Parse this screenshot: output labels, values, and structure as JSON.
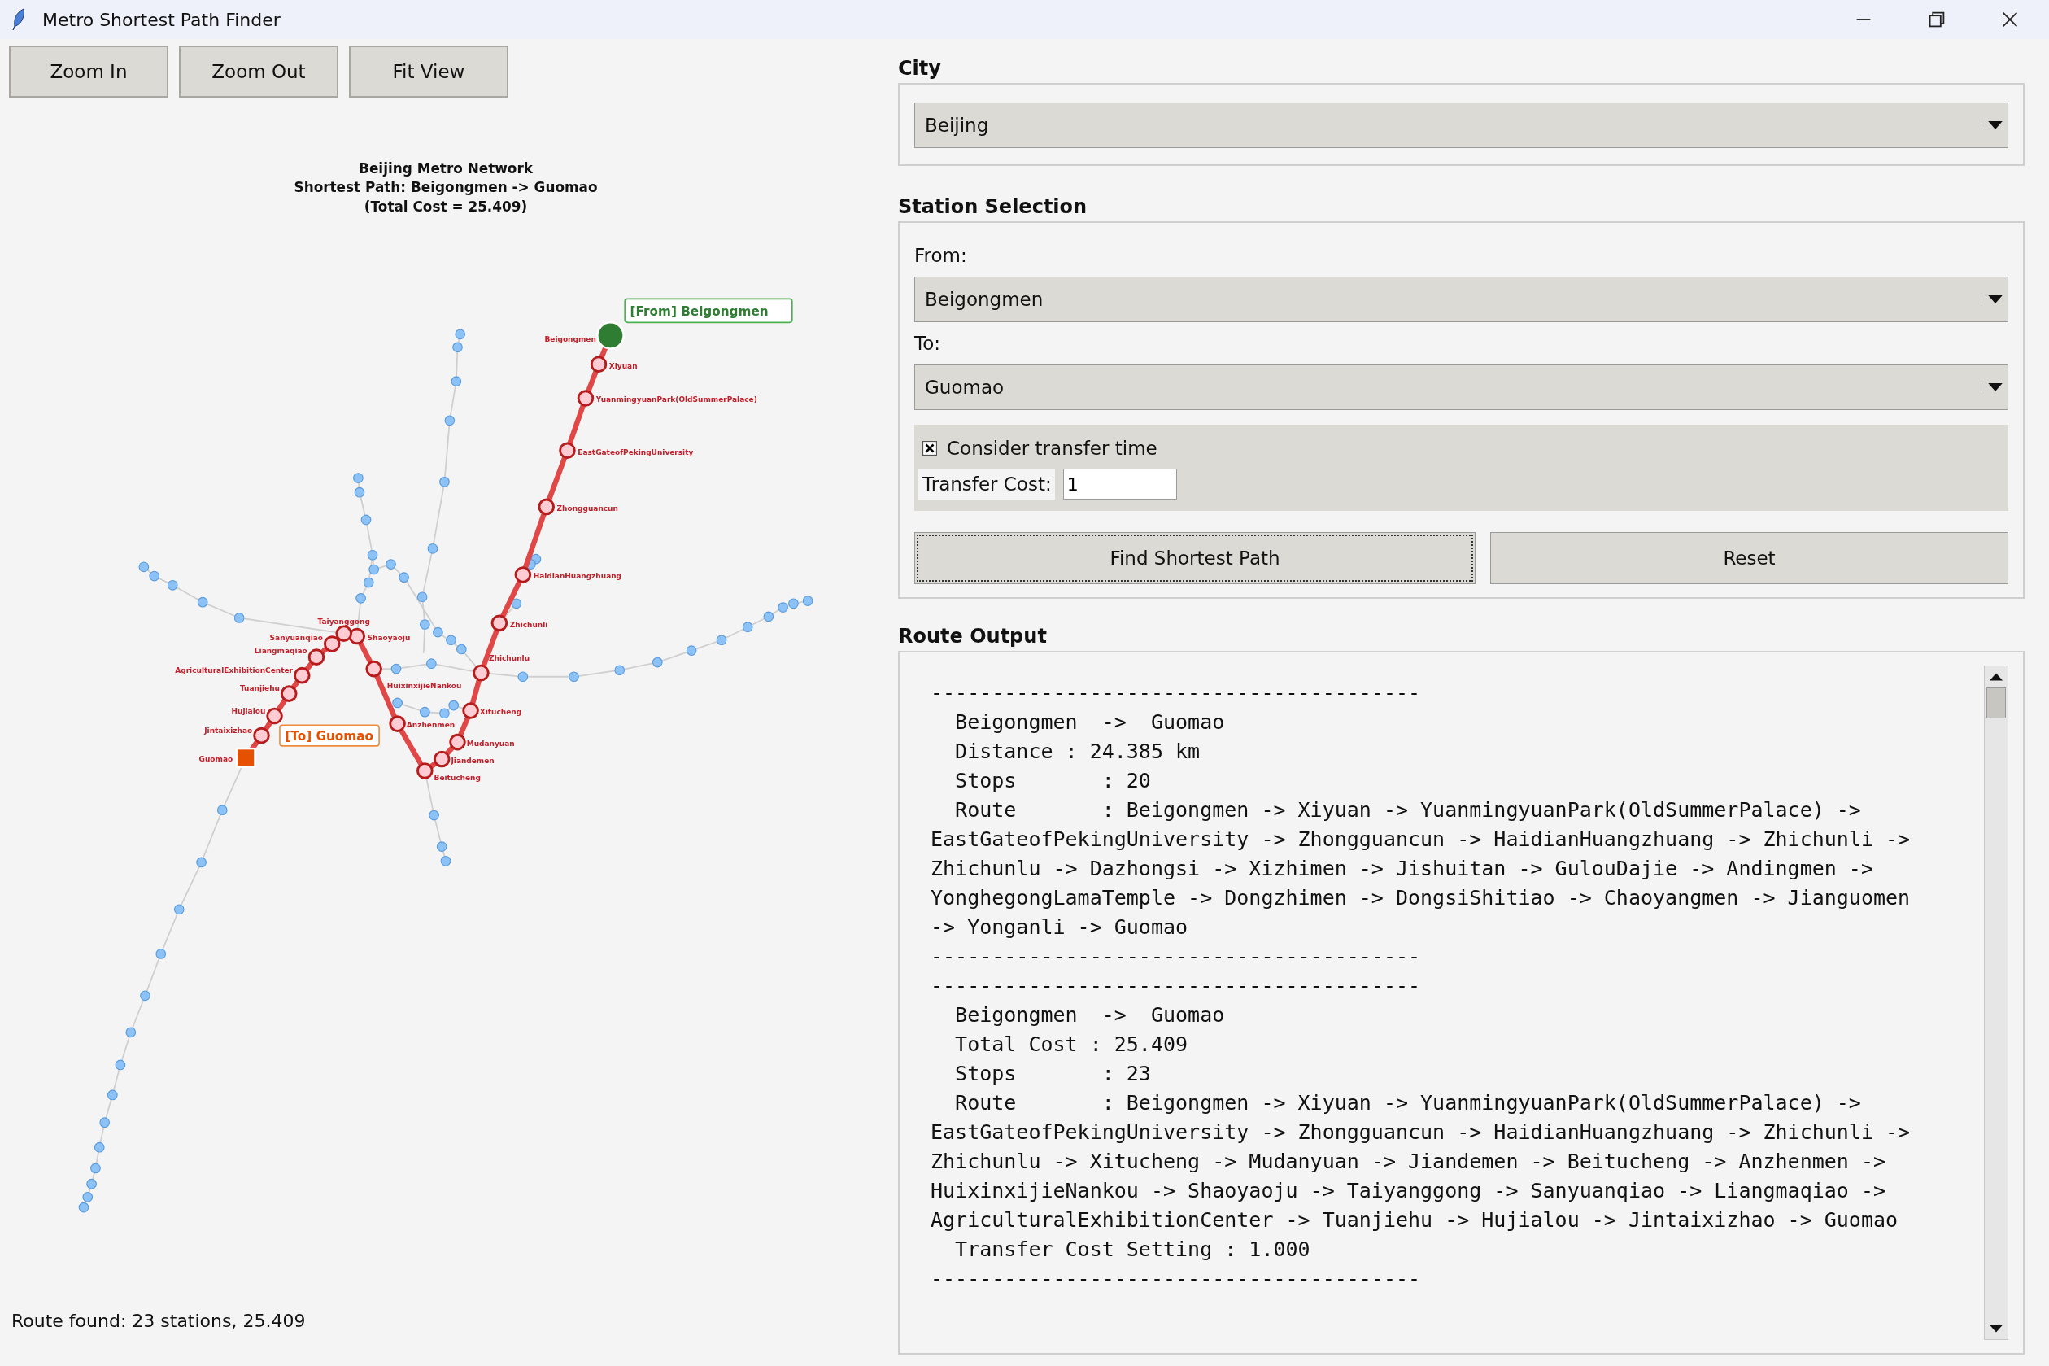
{
  "window": {
    "title": "Metro Shortest Path Finder"
  },
  "toolbar": [
    {
      "label": "Zoom In"
    },
    {
      "label": "Zoom Out"
    },
    {
      "label": "Fit View"
    }
  ],
  "map": {
    "title_lines": [
      "Beijing Metro Network",
      "Shortest Path: Beigongmen -> Guomao",
      "(Total Cost = 25.409)"
    ],
    "from_callout": "[From] Beigongmen",
    "to_callout": "[To] Guomao",
    "path_stations": [
      {
        "name": "Beigongmen"
      },
      {
        "name": "Xiyuan"
      },
      {
        "name": "YuanmingyuanPark(OldSummerPalace)"
      },
      {
        "name": "EastGateofPekingUniversity"
      },
      {
        "name": "Zhongguancun"
      },
      {
        "name": "HaidianHuangzhuang"
      },
      {
        "name": "Zhichunli"
      },
      {
        "name": "Zhichunlu"
      },
      {
        "name": "Xitucheng"
      },
      {
        "name": "Mudanyuan"
      },
      {
        "name": "Jiandemen"
      },
      {
        "name": "Beitucheng"
      },
      {
        "name": "Anzhenmen"
      },
      {
        "name": "HuixinxijieNankou"
      },
      {
        "name": "Shaoyaoju"
      },
      {
        "name": "Taiyanggong"
      },
      {
        "name": "Sanyuanqiao"
      },
      {
        "name": "Liangmaqiao"
      },
      {
        "name": "AgriculturalExhibitionCenter"
      },
      {
        "name": "Tuanjiehu"
      },
      {
        "name": "Hujialou"
      },
      {
        "name": "Jintaixizhao"
      },
      {
        "name": "Guomao"
      }
    ]
  },
  "status_bar": "Route found: 23 stations, 25.409",
  "city": {
    "label": "City",
    "value": "Beijing"
  },
  "station_selection": {
    "label": "Station Selection",
    "from": {
      "label": "From:",
      "value": "Beigongmen"
    },
    "to": {
      "label": "To:",
      "value": "Guomao"
    },
    "consider_transfer": {
      "label": "Consider transfer time",
      "checked": true
    },
    "transfer_cost": {
      "label": "Transfer Cost:",
      "value": "1"
    },
    "buttons": [
      {
        "label": "Find Shortest Path",
        "focused": true
      },
      {
        "label": "Reset",
        "focused": false
      }
    ]
  },
  "route_output": {
    "label": "Route Output",
    "lines": [
      "----------------------------------------",
      "  Beigongmen  ->  Guomao",
      "  Distance : 24.385 km",
      "  Stops       : 20",
      "  Route       : Beigongmen -> Xiyuan -> YuanmingyuanPark(OldSummerPalace) ->",
      "EastGateofPekingUniversity -> Zhongguancun -> HaidianHuangzhuang -> Zhichunli ->",
      "Zhichunlu -> Dazhongsi -> Xizhimen -> Jishuitan -> GulouDajie -> Andingmen ->",
      "YonghegongLamaTemple -> Dongzhimen -> DongsiShitiao -> Chaoyangmen -> Jianguomen",
      "-> Yonganli -> Guomao",
      "----------------------------------------",
      "----------------------------------------",
      "  Beigongmen  ->  Guomao",
      "  Total Cost : 25.409",
      "  Stops       : 23",
      "  Route       : Beigongmen -> Xiyuan -> YuanmingyuanPark(OldSummerPalace) ->",
      "EastGateofPekingUniversity -> Zhongguancun -> HaidianHuangzhuang -> Zhichunli ->",
      "Zhichunlu -> Xitucheng -> Mudanyuan -> Jiandemen -> Beitucheng -> Anzhenmen ->",
      "HuixinxijieNankou -> Shaoyaoju -> Taiyanggong -> Sanyuanqiao -> Liangmaqiao ->",
      "AgriculturalExhibitionCenter -> Tuanjiehu -> Hujialou -> Jintaixizhao -> Guomao",
      "  Transfer Cost Setting : 1.000",
      "----------------------------------------"
    ]
  }
}
